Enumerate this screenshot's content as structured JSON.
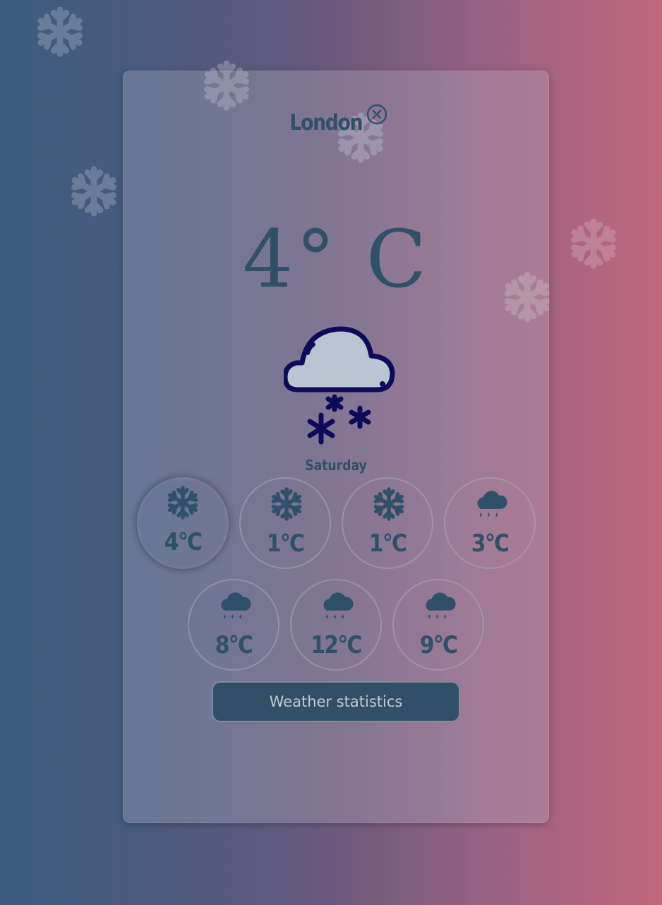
{
  "header": {
    "city": "London",
    "close_icon": "close-circle-icon"
  },
  "current": {
    "temperature": "4° C",
    "icon": "cloud-snow-icon",
    "day": "Saturday"
  },
  "forecast": [
    {
      "temp": "4°C",
      "icon": "snowflake-icon",
      "selected": true
    },
    {
      "temp": "1°C",
      "icon": "snowflake-icon",
      "selected": false
    },
    {
      "temp": "1°C",
      "icon": "snowflake-icon",
      "selected": false
    },
    {
      "temp": "3°C",
      "icon": "rain-cloud-icon",
      "selected": false
    },
    {
      "temp": "8°C",
      "icon": "rain-cloud-icon",
      "selected": false
    },
    {
      "temp": "12°C",
      "icon": "rain-cloud-icon",
      "selected": false
    },
    {
      "temp": "9°C",
      "icon": "rain-cloud-icon",
      "selected": false
    }
  ],
  "actions": {
    "stats_label": "Weather statistics"
  },
  "colors": {
    "text_primary": "#2e5069",
    "icon_outline": "#0d0a5c",
    "cloud_fill": "#b9c6d2",
    "button_bg": "#315067",
    "gradient_left": "#3a5c7d",
    "gradient_right": "#c0677e"
  },
  "background_decor": "snowflake-icon"
}
